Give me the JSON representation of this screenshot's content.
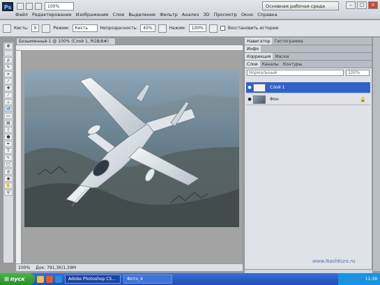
{
  "menu": {
    "items": [
      "Файл",
      "Редактирование",
      "Изображение",
      "Слои",
      "Выделение",
      "Фильтр",
      "Анализ",
      "3D",
      "Просмотр",
      "Окно",
      "Справка"
    ],
    "zoom": "100%",
    "workspace": "Основная рабочая среда"
  },
  "options": {
    "brush_label": "Кисть:",
    "brush_size": "9",
    "mode_label": "Режим:",
    "mode_value": "Кисть",
    "opacity_label": "Непрозрачность:",
    "opacity_value": "45%",
    "flow_label": "Нажим:",
    "flow_value": "100%",
    "history_label": "Восстановить историю"
  },
  "document": {
    "tab": "Безымянный-1 @ 100% (Слой 1, RGB/8#)",
    "zoom": "100%",
    "doc_info": "Док: 791,3К/1,59М"
  },
  "panels": {
    "top_tabs": [
      "Навигатор",
      "Гистограмма"
    ],
    "mid_tabs": [
      "Инфо"
    ],
    "color_tabs": [
      "Коррекция",
      "Маски"
    ],
    "layer_tabs": [
      "Слои",
      "Каналы",
      "Контуры"
    ],
    "blend_mode": "Нормальный",
    "opacity": "100%",
    "layers": [
      {
        "name": "Слой 1",
        "selected": true
      },
      {
        "name": "Фон",
        "selected": false
      }
    ]
  },
  "watermark": "www.NashKurs.ru",
  "taskbar": {
    "start": "пуск",
    "tasks": [
      "Adobe Photoshop CS...",
      "Фото_4"
    ],
    "clock": "11:39"
  },
  "colors": {
    "foreground": "#1240d8",
    "background": "#ffffff",
    "selection": "#3262c8"
  }
}
